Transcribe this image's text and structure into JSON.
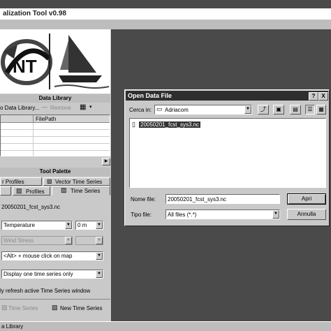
{
  "main_window": {
    "title": "alization Tool v0.98",
    "status_bar": "a Library"
  },
  "data_library": {
    "heading": "Data Library",
    "add_label": "o Data Library...",
    "remove_label": "Remove",
    "table_header": [
      "",
      "FilePath"
    ]
  },
  "tool_palette": {
    "heading": "Tool Palette",
    "tabs_row1": [
      "r Profiles",
      "Vector Time Series"
    ],
    "tabs_row2": [
      "",
      "Profiles",
      "Time Series"
    ],
    "file_label": "20050201_fcst_sys3.nc",
    "variable_select": "Temperature",
    "depth_select": "0 m",
    "wind_select": "Wind Stress",
    "click_mode_select": "<Alt> + mouse click on map",
    "display_mode_select": "Display one time series only",
    "refresh_checkbox_label": "ly refresh active Time Series window",
    "bottom_buttons": [
      "Time Series",
      "New Time Series"
    ]
  },
  "dialog": {
    "title": "Open Data File",
    "help_btn": "?",
    "close_btn": "X",
    "look_in_label": "Cerca in:",
    "look_in_value": "Adriacom",
    "files": [
      "20050201_fcst_sys3.nc"
    ],
    "filename_label": "Nome file:",
    "filename_value": "20050201_fcst_sys3.nc",
    "filetype_label": "Tipo file:",
    "filetype_value": "All files (*.*)",
    "open_button": "Apri",
    "cancel_button": "Annulla"
  }
}
